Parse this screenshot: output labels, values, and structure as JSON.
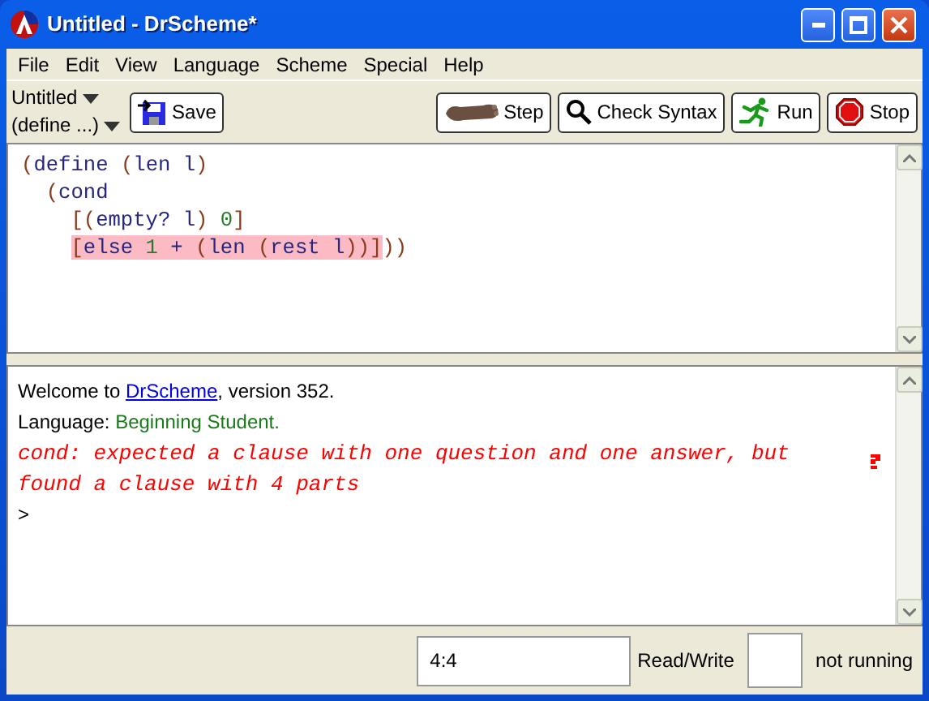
{
  "window": {
    "title": "Untitled - DrScheme*"
  },
  "menu": [
    "File",
    "Edit",
    "View",
    "Language",
    "Scheme",
    "Special",
    "Help"
  ],
  "toolbar": {
    "file_menu": "Untitled",
    "define_menu": "(define ...)",
    "save": "Save",
    "buttons": [
      {
        "kind": "step",
        "label": "Step"
      },
      {
        "kind": "check",
        "label": "Check Syntax"
      },
      {
        "kind": "run",
        "label": "Run"
      },
      {
        "kind": "stop",
        "label": "Stop"
      }
    ]
  },
  "definitions": [
    {
      "segments": [
        {
          "text": "(define (len l)",
          "highlighted": false
        }
      ],
      "children": [
        {
          "segments": [
            {
              "text": "(cond",
              "highlighted": false
            }
          ],
          "children": [
            {
              "segments": [
                {
                  "text": "[(empty? l) 0]",
                  "highlighted": false
                }
              ]
            },
            {
              "segments": [
                {
                  "text": "[else 1 + (len (rest l))]",
                  "highlighted": true
                },
                {
                  "text": "))",
                  "highlighted": false
                }
              ]
            }
          ]
        }
      ]
    }
  ],
  "interactions": {
    "welcome": {
      "before": "Welcome to ",
      "link": "DrScheme",
      "after": ", version 352."
    },
    "language": {
      "label": "Language: ",
      "value": "Beginning Student."
    },
    "error": [
      "cond: expected a clause with one question and one answer, but",
      "found a clause with 4 parts"
    ],
    "prompt": ">"
  },
  "status_bar": {
    "position": "4:4",
    "mode": "Read/Write",
    "state": "not running"
  }
}
